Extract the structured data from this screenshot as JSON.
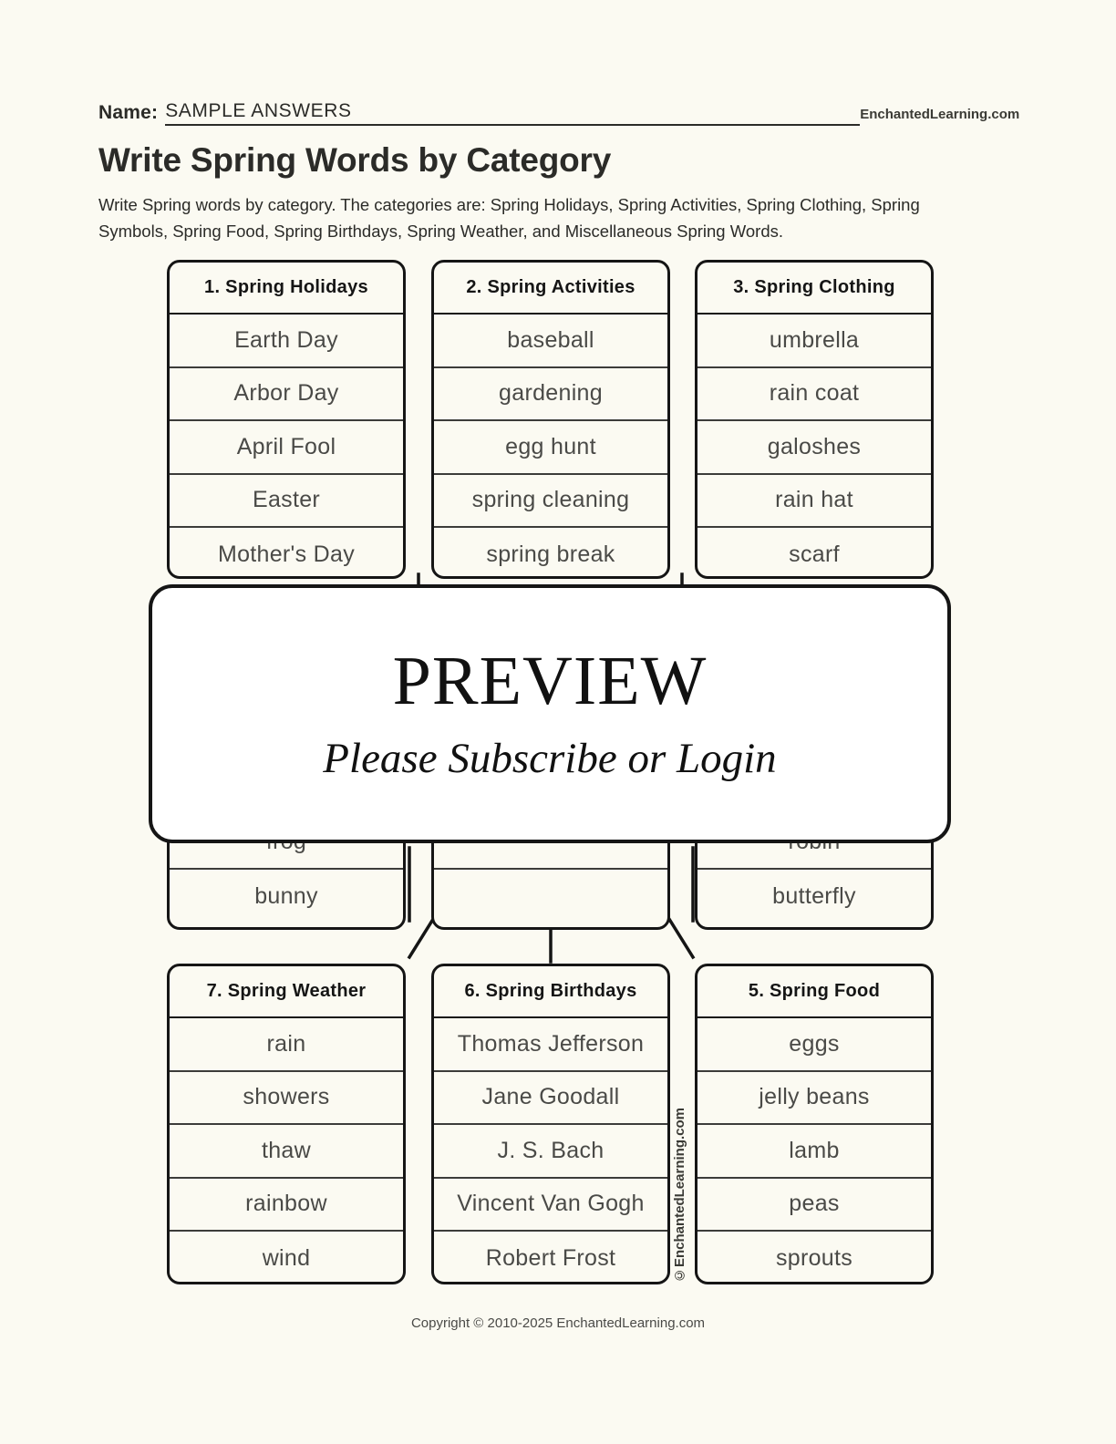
{
  "header": {
    "name_label": "Name:",
    "name_value": "SAMPLE ANSWERS",
    "brand": "EnchantedLearning.com"
  },
  "title": "Write Spring Words by Category",
  "description": "Write Spring words by category. The categories are: Spring Holidays, Spring Activities, Spring Clothing, Spring Symbols, Spring Food, Spring Birthdays, Spring Weather, and Miscellaneous Spring Words.",
  "categories": [
    {
      "id": "spring-holidays",
      "heading": "1. Spring Holidays",
      "items": [
        "Earth Day",
        "Arbor Day",
        "April Fool",
        "Easter",
        "Mother's Day"
      ]
    },
    {
      "id": "spring-activities",
      "heading": "2. Spring Activities",
      "items": [
        "baseball",
        "gardening",
        "egg hunt",
        "spring cleaning",
        "spring break"
      ]
    },
    {
      "id": "spring-clothing",
      "heading": "3. Spring Clothing",
      "items": [
        "umbrella",
        "rain coat",
        "galoshes",
        "rain hat",
        "scarf"
      ]
    },
    {
      "id": "spring-symbols",
      "heading": "",
      "items": [
        "",
        "",
        "",
        "frog",
        "bunny"
      ]
    },
    {
      "id": "misc-spring-words",
      "heading": "",
      "items": [
        "",
        "",
        "",
        "",
        ""
      ]
    },
    {
      "id": "spring-animals",
      "heading": "",
      "items": [
        "",
        "",
        "",
        "robin",
        "butterfly"
      ]
    },
    {
      "id": "spring-weather",
      "heading": "7. Spring Weather",
      "items": [
        "rain",
        "showers",
        "thaw",
        "rainbow",
        "wind"
      ]
    },
    {
      "id": "spring-birthdays",
      "heading": "6. Spring Birthdays",
      "items": [
        "Thomas Jefferson",
        "Jane Goodall",
        "J. S. Bach",
        "Vincent Van Gogh",
        "Robert Frost"
      ]
    },
    {
      "id": "spring-food",
      "heading": "5. Spring Food",
      "items": [
        "eggs",
        "jelly beans",
        "lamb",
        "peas",
        "sprouts"
      ]
    }
  ],
  "overlay": {
    "title": "PREVIEW",
    "subtitle": "Please Subscribe or Login"
  },
  "watermark": "©EnchantedLearning.com",
  "footer": "Copyright © 2010-2025 EnchantedLearning.com",
  "colors": {
    "page_background": "#fbfaf2",
    "ink": "#151515",
    "text": "#2b2b28",
    "answer_text": "#4a4a47",
    "overlay_background": "#ffffff"
  }
}
